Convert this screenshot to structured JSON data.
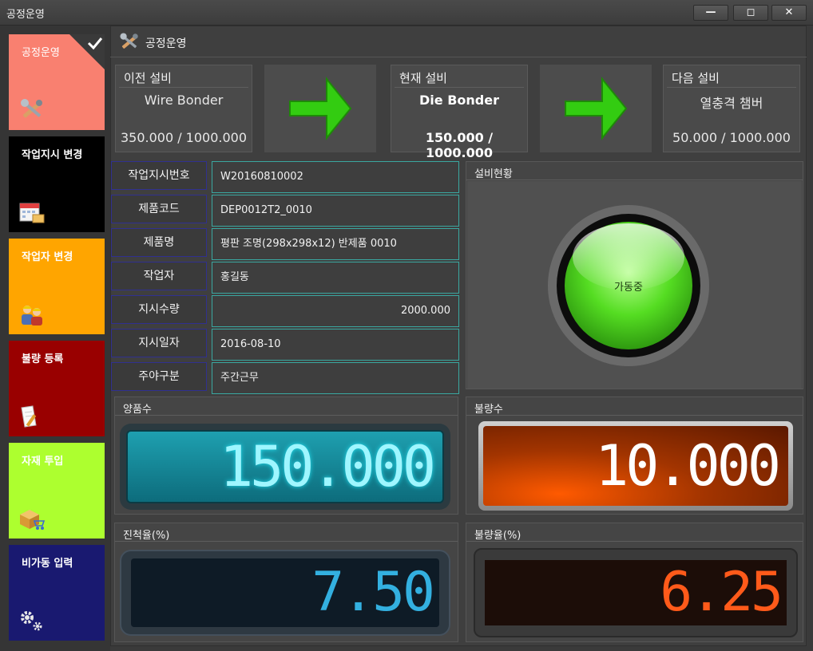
{
  "window": {
    "title": "공정운영",
    "min_icon": "minimize-icon",
    "max_icon": "maximize-icon",
    "close_icon": "close-icon",
    "min": "—",
    "max": "◻",
    "close": "✕"
  },
  "sidebar": {
    "items": [
      {
        "label": "공정운영",
        "color": "#f98070",
        "icon": "tools-icon",
        "checked": true
      },
      {
        "label": "작업지시 변경",
        "color": "#000000",
        "icon": "calendar-icon"
      },
      {
        "label": "작업자 변경",
        "color": "#ffa500",
        "icon": "workers-icon"
      },
      {
        "label": "불량 등록",
        "color": "#990000",
        "icon": "edit-document-icon"
      },
      {
        "label": "자재 투입",
        "color": "#adff2f",
        "icon": "box-cart-icon"
      },
      {
        "label": "비가동 입력",
        "color": "#191970",
        "icon": "gears-icon"
      }
    ]
  },
  "header": {
    "title": "공정운영",
    "icon": "tools-icon"
  },
  "equipment": {
    "previous": {
      "label": "이전 설비",
      "name": "Wire Bonder",
      "value": "350.000 / 1000.000"
    },
    "current": {
      "label": "현재 설비",
      "name": "Die Bonder",
      "value": "150.000 / 1000.000"
    },
    "next": {
      "label": "다음 설비",
      "name": "열충격 챔버",
      "value": "50.000 / 1000.000"
    },
    "arrow_color": "#33cc11"
  },
  "work_order": [
    {
      "label": "작업지시번호",
      "value": "W20160810002"
    },
    {
      "label": "제품코드",
      "value": "DEP0012T2_0010"
    },
    {
      "label": "제품명",
      "value": "평판 조명(298x298x12) 반제품 0010"
    },
    {
      "label": "작업자",
      "value": "홍길동"
    },
    {
      "label": "지시수량",
      "value": "2000.000"
    },
    {
      "label": "지시일자",
      "value": "2016-08-10"
    },
    {
      "label": "주야구분",
      "value": "주간근무"
    }
  ],
  "status": {
    "title": "설비현황",
    "state": "가동중",
    "color": "#55dd22"
  },
  "counters": {
    "good": {
      "title": "양품수",
      "value": "150.000",
      "color": "#22e0f0"
    },
    "defect": {
      "title": "불량수",
      "value": "10.000",
      "color": "#ffffff"
    },
    "progress": {
      "title": "진척율(%)",
      "value": "7.50",
      "color": "#33b0e0"
    },
    "defect_rate": {
      "title": "불량율(%)",
      "value": "6.25",
      "color": "#ff5a1a"
    }
  }
}
